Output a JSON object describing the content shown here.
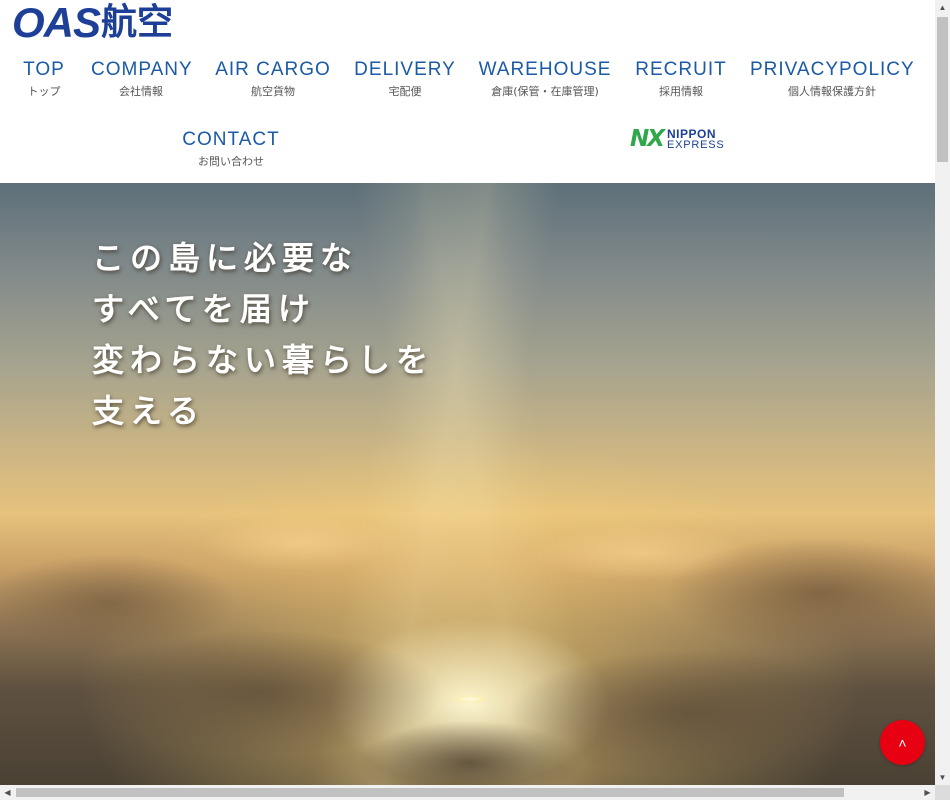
{
  "header": {
    "logo_latin": "OAS",
    "logo_jp": "航空",
    "partner_logo": {
      "mark": "NX",
      "line1": "NIPPON",
      "line2": "EXPRESS",
      "mark_color": "#2ea84a",
      "text_color": "#1d3f97"
    }
  },
  "nav": {
    "items": [
      {
        "en": "TOP",
        "jp": "トップ"
      },
      {
        "en": "COMPANY",
        "jp": "会社情報"
      },
      {
        "en": "AIR CARGO",
        "jp": "航空貨物"
      },
      {
        "en": "DELIVERY",
        "jp": "宅配便"
      },
      {
        "en": "WAREHOUSE",
        "jp": "倉庫(保管・在庫管理)"
      },
      {
        "en": "RECRUIT",
        "jp": "採用情報"
      },
      {
        "en": "PRIVACYPOLICY",
        "jp": "個人情報保護方針"
      },
      {
        "en": "CONTACT",
        "jp": "お問い合わせ"
      }
    ]
  },
  "hero": {
    "tagline": [
      "この島に必要な",
      "すべてを届け",
      "変わらない暮らしを",
      "支える"
    ]
  },
  "back_to_top": {
    "icon": "chevron-up-icon",
    "glyph": "˄",
    "color": "#e60012"
  },
  "scrollbars": {
    "vertical_icon_up": "▲",
    "vertical_icon_down": "▼",
    "horizontal_icon_left": "◀",
    "horizontal_icon_right": "▶"
  },
  "colors": {
    "brand_blue": "#1d3f97",
    "nav_blue": "#1a5aa6"
  }
}
